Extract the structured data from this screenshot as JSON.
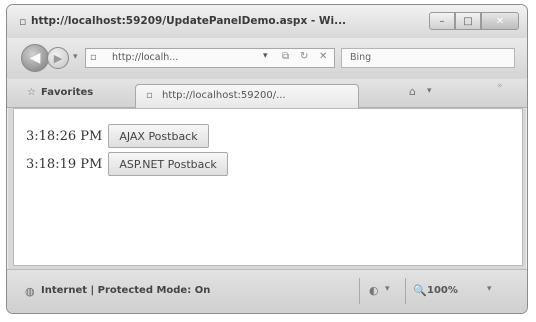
{
  "window": {
    "title": "http://localhost:59209/UpdatePanelDemo.aspx - Wi...",
    "controls": [
      "–",
      "□",
      "✕"
    ]
  },
  "nav": {
    "address": "http://localh...",
    "search_placeholder": "Bing"
  },
  "tabs": {
    "favorites_label": "Favorites",
    "active_tab": "http://localhost:59200/..."
  },
  "page": {
    "rows": [
      {
        "time": "3:18:26 PM",
        "button": "AJAX Postback"
      },
      {
        "time": "3:18:19 PM",
        "button": "ASP.NET Postback"
      }
    ]
  },
  "status": {
    "zone": "Internet | Protected Mode: On",
    "zoom": "100%"
  },
  "icons": {
    "back": "back-arrow-icon",
    "forward": "forward-arrow-icon",
    "refresh": "refresh-icon",
    "stop": "stop-icon",
    "search": "search-icon",
    "favorites": "favorites-star-icon",
    "home": "home-icon",
    "globe": "globe-icon",
    "zoom": "zoom-icon"
  }
}
